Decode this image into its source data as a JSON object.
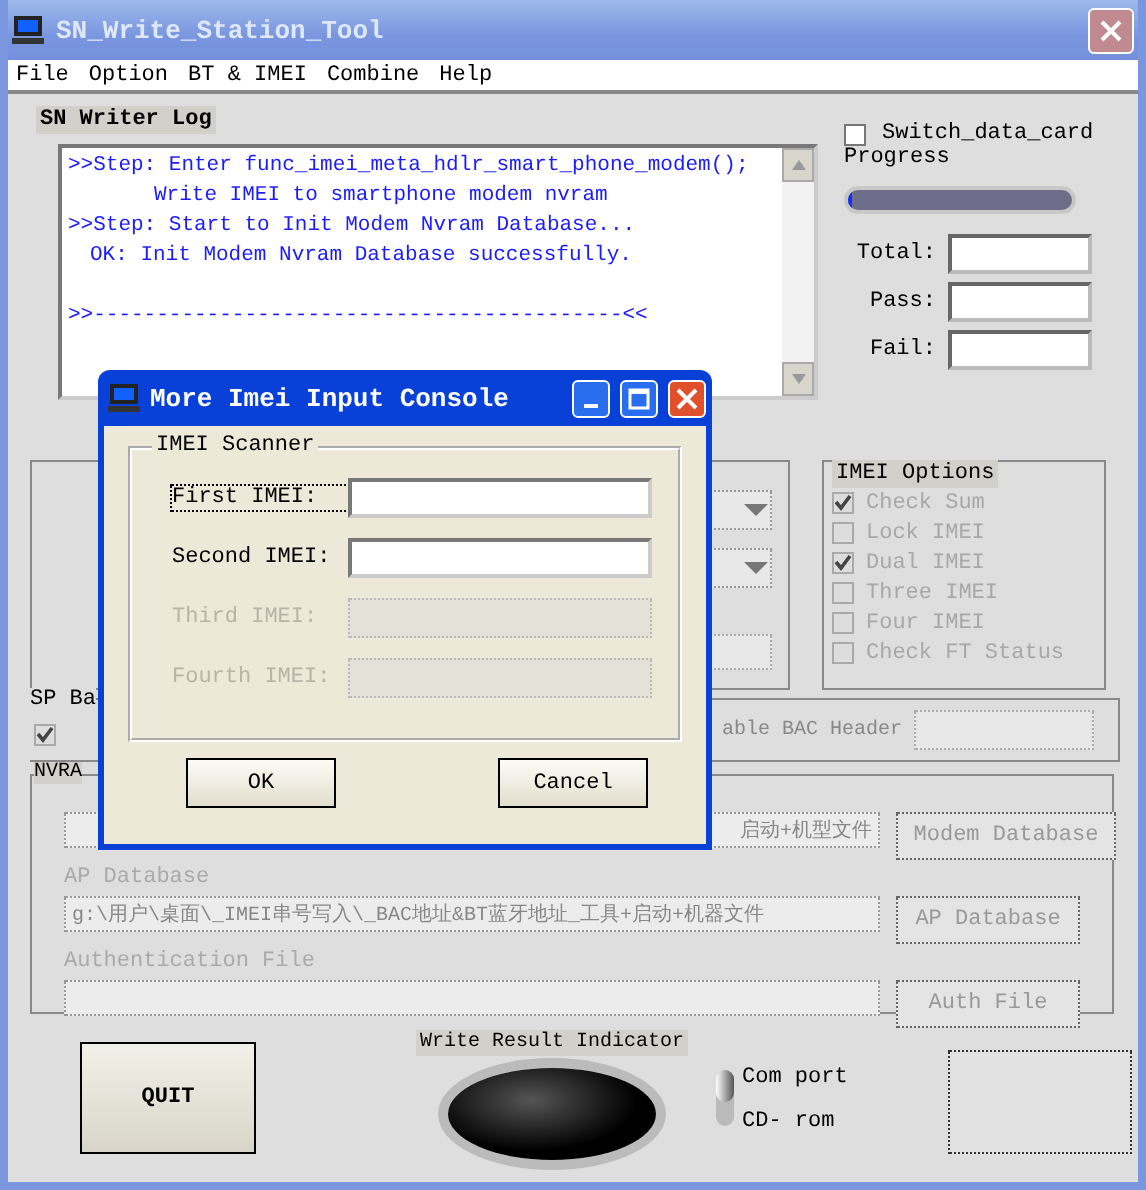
{
  "window": {
    "title": "SN_Write_Station_Tool"
  },
  "menu": [
    {
      "label": "File"
    },
    {
      "label": "Option"
    },
    {
      "label": "BT & IMEI"
    },
    {
      "label": "Combine"
    },
    {
      "label": "Help"
    }
  ],
  "log": {
    "title": "SN Writer Log",
    "lines": [
      {
        "kind": "step",
        "text": ">>Step: Enter func_imei_meta_hdlr_smart_phone_modem();"
      },
      {
        "kind": "detail",
        "text": "Write IMEI to smartphone modem nvram"
      },
      {
        "kind": "step",
        "text": ">>Step: Start to Init Modem Nvram Database..."
      },
      {
        "kind": "result",
        "text": "OK: Init Modem Nvram Database successfully."
      },
      {
        "kind": "separator",
        "text": ">>------------------------------------------<<"
      }
    ]
  },
  "switch_data_card": {
    "label": "Switch_data_card",
    "checked": false
  },
  "progress": {
    "label": "Progress",
    "level": 0.02
  },
  "counters": [
    {
      "label": "Total:"
    },
    {
      "label": "Pass:"
    },
    {
      "label": "Fail:"
    }
  ],
  "imei_options": {
    "title": "IMEI Options",
    "items": [
      {
        "label": "Check Sum",
        "checked": true,
        "disabled": true
      },
      {
        "label": "Lock IMEI",
        "checked": false,
        "disabled": true
      },
      {
        "label": "Dual IMEI",
        "checked": true,
        "disabled": true
      },
      {
        "label": "Three IMEI",
        "checked": false,
        "disabled": true
      },
      {
        "label": "Four IMEI",
        "checked": false,
        "disabled": true
      },
      {
        "label": "Check FT Status",
        "checked": false,
        "disabled": true
      }
    ]
  },
  "sp_section": {
    "label": "SP Ba",
    "checkbox": {
      "checked": true,
      "disabled": true
    },
    "header_label": "able BAC Header"
  },
  "nvram": {
    "label": "NVRA",
    "modem_database": {
      "value": "启动+机型文件",
      "button": "Modem Database"
    },
    "ap_database": {
      "label": "AP Database",
      "value": "g:\\用户\\桌面\\_IMEI串号写入\\_BAC地址&BT蓝牙地址_工具+启动+机器文件",
      "button": "AP Database"
    },
    "authentication": {
      "label": "Authentication File",
      "button": "Auth File"
    }
  },
  "footer": {
    "quit": "QUIT",
    "indicator_label": "Write Result Indicator",
    "toggle": {
      "labels": [
        "Com port",
        "CD- rom"
      ],
      "on": true
    }
  },
  "dialog": {
    "title": "More Imei Input Console",
    "group": "IMEI Scanner",
    "fields": [
      {
        "label": "First IMEI:",
        "disabled": false,
        "focused": true
      },
      {
        "label": "Second IMEI:",
        "disabled": false,
        "focused": false
      },
      {
        "label": "Third IMEI:",
        "disabled": true,
        "focused": false
      },
      {
        "label": "Fourth IMEI:",
        "disabled": true,
        "focused": false
      }
    ],
    "buttons": [
      "OK",
      "Cancel"
    ]
  }
}
